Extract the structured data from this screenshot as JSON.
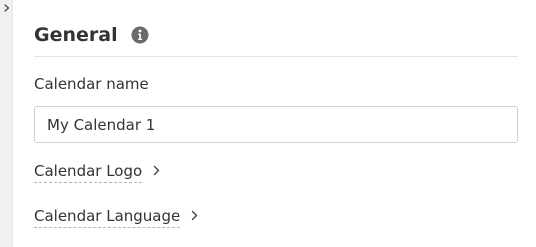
{
  "sidebar": {
    "expand_icon": "chevron-right-icon"
  },
  "section": {
    "title": "General",
    "info_icon": "info-circle-icon"
  },
  "calendar_name": {
    "label": "Calendar name",
    "value": "My Calendar 1"
  },
  "links": {
    "logo_label": "Calendar Logo",
    "language_label": "Calendar Language",
    "chevron_icon": "chevron-right-icon"
  },
  "colors": {
    "text": "#333333",
    "divider": "#e5e5e5",
    "input_border": "#cfcfcf",
    "icon": "#666666",
    "rail": "#f1f1f1"
  }
}
